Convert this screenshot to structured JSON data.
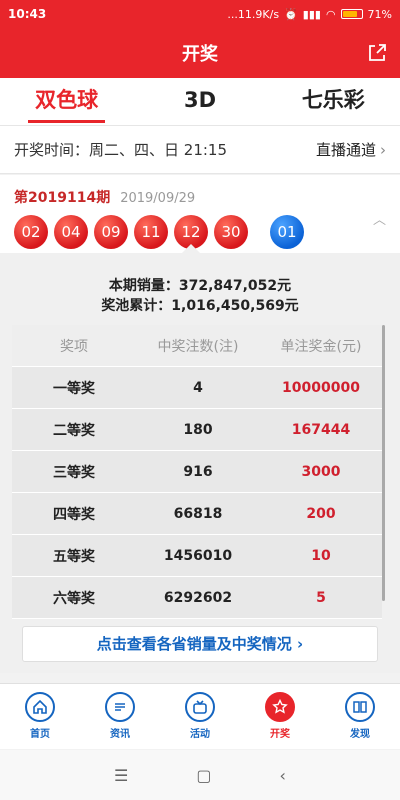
{
  "status": {
    "time": "10:43",
    "network_speed": "...11.9K/s",
    "battery": "71%"
  },
  "header": {
    "title": "开奖"
  },
  "lottery_tabs": [
    {
      "label": "双色球",
      "active": true
    },
    {
      "label": "3D",
      "active": false
    },
    {
      "label": "七乐彩",
      "active": false
    }
  ],
  "schedule": {
    "text": "开奖时间：周二、四、日 21:15",
    "live_label": "直播通道"
  },
  "draw": {
    "issue": "第2019114期",
    "date": "2019/09/29",
    "red_balls": [
      "02",
      "04",
      "09",
      "11",
      "12",
      "30"
    ],
    "blue_ball": "01"
  },
  "sales": {
    "sales_line": "本期销量：372,847,052元",
    "pool_line": "奖池累计：1,016,450,569元"
  },
  "prize_table": {
    "headers": [
      "奖项",
      "中奖注数(注)",
      "单注奖金(元)"
    ],
    "rows": [
      [
        "一等奖",
        "4",
        "10000000"
      ],
      [
        "二等奖",
        "180",
        "167444"
      ],
      [
        "三等奖",
        "916",
        "3000"
      ],
      [
        "四等奖",
        "66818",
        "200"
      ],
      [
        "五等奖",
        "1456010",
        "10"
      ],
      [
        "六等奖",
        "6292602",
        "5"
      ]
    ]
  },
  "province_link": "点击查看各省销量及中奖情况",
  "bottom_nav": [
    {
      "label": "首页",
      "icon": "home-icon"
    },
    {
      "label": "资讯",
      "icon": "news-icon"
    },
    {
      "label": "活动",
      "icon": "activity-icon"
    },
    {
      "label": "开奖",
      "icon": "star-icon",
      "active": true
    },
    {
      "label": "发现",
      "icon": "book-icon"
    }
  ],
  "colors": {
    "brand_red": "#e8252b",
    "blue": "#1565c0"
  }
}
